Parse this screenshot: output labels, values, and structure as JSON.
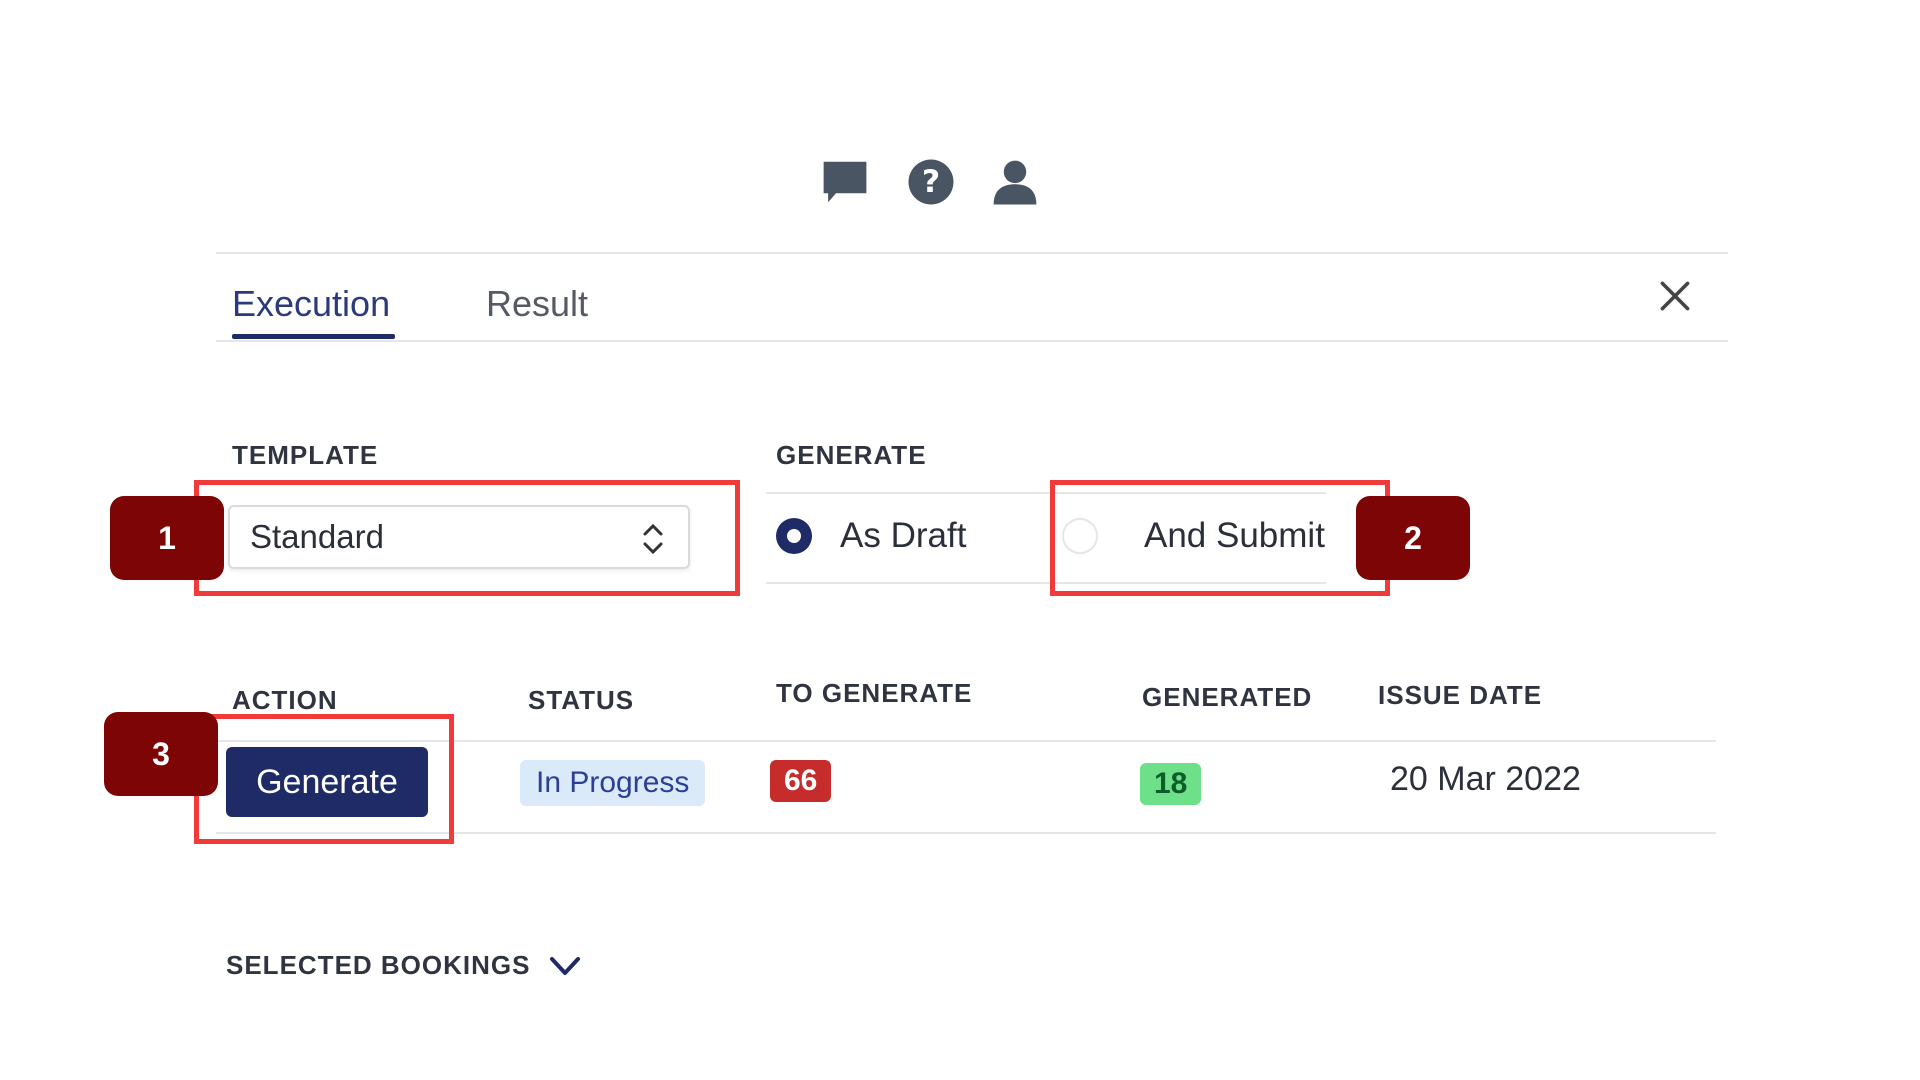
{
  "header_icons": [
    {
      "name": "chat-icon"
    },
    {
      "name": "help-icon"
    },
    {
      "name": "user-icon"
    }
  ],
  "tabs": [
    {
      "label": "Execution",
      "active": true
    },
    {
      "label": "Result",
      "active": false
    }
  ],
  "template": {
    "label": "TEMPLATE",
    "selected": "Standard"
  },
  "generate": {
    "label": "GENERATE",
    "options": [
      {
        "label": "As Draft",
        "checked": true
      },
      {
        "label": "And Submit",
        "checked": false
      }
    ]
  },
  "table": {
    "headers": [
      "ACTION",
      "STATUS",
      "TO GENERATE",
      "GENERATED",
      "ISSUE DATE"
    ],
    "row": {
      "action": "Generate",
      "status": "In Progress",
      "to_generate": "66",
      "generated": "18",
      "issue_date": "20 Mar 2022"
    }
  },
  "selected_bookings": {
    "label": "SELECTED BOOKINGS"
  },
  "markers": [
    "1",
    "2",
    "3"
  ],
  "colors": {
    "primary": "#1e2b66",
    "highlight": "#f13a3a",
    "marker": "#7d0505",
    "status_badge": "#dbeaf9",
    "to_generate_badge": "#c62c2c",
    "generated_badge": "#6ee08a"
  }
}
